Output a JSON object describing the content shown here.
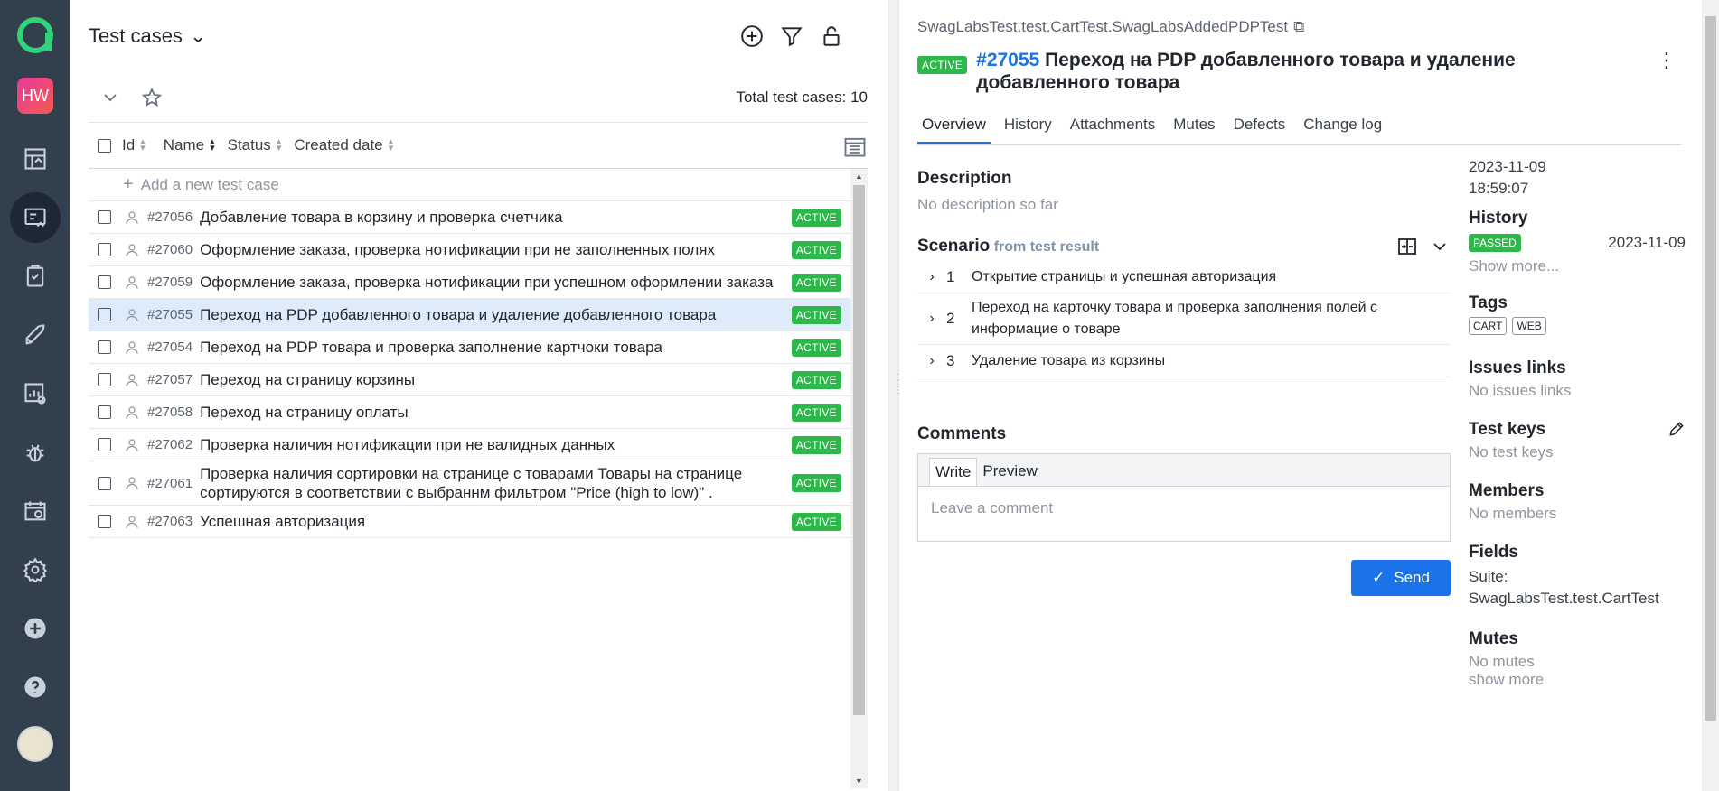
{
  "rail": {
    "workspace_initials": "HW",
    "nav": [
      "dashboard-icon",
      "test-cases-icon",
      "test-plans-icon",
      "launches-icon",
      "analytics-icon",
      "defects-icon",
      "jobs-icon",
      "settings-icon",
      "add-icon",
      "help-icon"
    ]
  },
  "mid": {
    "title": "Test cases",
    "total": "Total test cases: 10",
    "columns": {
      "id": "Id",
      "name": "Name",
      "status": "Status",
      "created": "Created date"
    },
    "add_label": "Add a new test case",
    "rows": [
      {
        "id": "#27056",
        "name": "Добавление товара в корзину и проверка счетчика",
        "status": "ACTIVE"
      },
      {
        "id": "#27060",
        "name": "Оформление заказа, проверка нотификации при не заполненных полях",
        "status": "ACTIVE"
      },
      {
        "id": "#27059",
        "name": "Оформление заказа, проверка нотификации при успешном оформлении заказа",
        "status": "ACTIVE"
      },
      {
        "id": "#27055",
        "name": "Переход на PDP добавленного товара и удаление добавленного товара",
        "status": "ACTIVE"
      },
      {
        "id": "#27054",
        "name": "Переход на PDP товара и проверка заполнение картчоки товара",
        "status": "ACTIVE"
      },
      {
        "id": "#27057",
        "name": "Переход на страницу корзины",
        "status": "ACTIVE"
      },
      {
        "id": "#27058",
        "name": "Переход на страницу оплаты",
        "status": "ACTIVE"
      },
      {
        "id": "#27062",
        "name": "Проверка наличия нотификации при не валидных данных",
        "status": "ACTIVE"
      },
      {
        "id": "#27061",
        "name": "Проверка наличия сортировки на странице с товарами Товары на странице сортируются в соответствии с выбраннм фильтром \"Price (high to low)\" .",
        "status": "ACTIVE"
      },
      {
        "id": "#27063",
        "name": "Успешная авторизация",
        "status": "ACTIVE"
      }
    ]
  },
  "detail": {
    "breadcrumb": "SwagLabsTest.test.CartTest.SwagLabsAddedPDPTest",
    "status": "ACTIVE",
    "id": "#27055",
    "title": "Переход на PDP добавленного товара и удаление добавленного товара",
    "tabs": [
      "Overview",
      "History",
      "Attachments",
      "Mutes",
      "Defects",
      "Change log"
    ],
    "description_title": "Description",
    "description": "No description so far",
    "scenario_title": "Scenario",
    "scenario_from": "from test result",
    "steps": [
      {
        "n": "1",
        "text": "Открытие страницы и успешная авторизация"
      },
      {
        "n": "2",
        "text": "Переход на карточку товара и проверка заполнения полей с информацие о товаре"
      },
      {
        "n": "3",
        "text": "Удаление товара из корзины"
      }
    ],
    "comments_title": "Comments",
    "write": "Write",
    "preview": "Preview",
    "comment_placeholder": "Leave a comment",
    "send": "Send",
    "side": {
      "date": "2023-11-09",
      "time": "18:59:07",
      "history_title": "History",
      "history_status": "PASSED",
      "history_date": "2023-11-09",
      "show_more": "Show more...",
      "tags_title": "Tags",
      "tags": [
        "CART",
        "WEB"
      ],
      "issues_title": "Issues links",
      "issues": "No issues links",
      "keys_title": "Test keys",
      "keys": "No test keys",
      "members_title": "Members",
      "members": "No members",
      "fields_title": "Fields",
      "suite_label": "Suite:",
      "suite_value": "SwagLabsTest.test.CartTest",
      "mutes_title": "Mutes",
      "mutes": "No mutes",
      "show_more_2": "show more"
    }
  },
  "colors": {
    "accent": "#1a73e8",
    "active_badge": "#2eb84c",
    "rail_bg": "#323f4d",
    "selected_row": "#deebfb"
  }
}
